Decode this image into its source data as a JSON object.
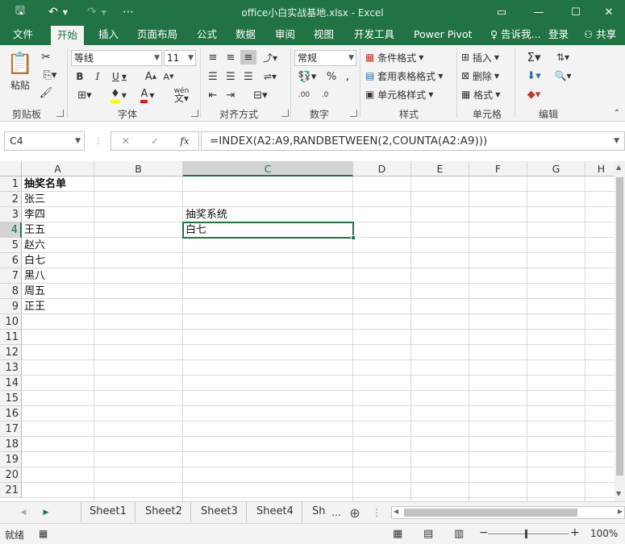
{
  "title": "office小白实战基地.xlsx - Excel",
  "quick_access": {
    "save": "🖫",
    "undo": "↶",
    "redo": "↷",
    "customize": "⋯"
  },
  "window": {
    "restore_icon": "▭",
    "minimize": "—",
    "maximize": "☐",
    "close": "✕"
  },
  "tabs": [
    "文件",
    "开始",
    "插入",
    "页面布局",
    "公式",
    "数据",
    "审阅",
    "视图",
    "开发工具",
    "Power Pivot"
  ],
  "active_tab": "开始",
  "tell_me": "告诉我...",
  "login": "登录",
  "share": "共享",
  "ribbon": {
    "clipboard": {
      "paste": "粘贴",
      "label": "剪贴板"
    },
    "font": {
      "name": "等线",
      "size": "11",
      "label": "字体",
      "bold": "B",
      "italic": "I",
      "underline": "U"
    },
    "alignment": {
      "label": "对齐方式"
    },
    "number": {
      "format": "常规",
      "label": "数字",
      "percent": "%",
      "comma": ","
    },
    "styles": {
      "conditional": "条件格式",
      "table": "套用表格格式",
      "cell_style": "单元格样式",
      "label": "样式"
    },
    "cells": {
      "insert": "插入",
      "delete": "删除",
      "format": "格式",
      "label": "单元格"
    },
    "editing": {
      "label": "编辑"
    }
  },
  "formula_bar": {
    "name_box": "C4",
    "cancel": "✕",
    "enter": "✓",
    "fx": "fx",
    "formula": "=INDEX(A2:A9,RANDBETWEEN(2,COUNTA(A2:A9)))"
  },
  "columns": [
    "A",
    "B",
    "C",
    "D",
    "E",
    "F",
    "G",
    "H"
  ],
  "rows": [
    "1",
    "2",
    "3",
    "4",
    "5",
    "6",
    "7",
    "8",
    "9",
    "10",
    "11",
    "12",
    "13",
    "14",
    "15",
    "16",
    "17",
    "18",
    "19",
    "20",
    "21"
  ],
  "cells": {
    "A1": "抽奖名单",
    "A2": "张三",
    "A3": "李四",
    "A4": "王五",
    "A5": "赵六",
    "A6": "白七",
    "A7": "黑八",
    "A8": "周五",
    "A9": "正王",
    "C3": "抽奖系统",
    "C4": "白七"
  },
  "selected_cell": "C4",
  "sheets": [
    "Sheet1",
    "Sheet2",
    "Sheet3",
    "Sheet4",
    "Sh"
  ],
  "sheet_nav": {
    "prev": "◀",
    "next": "▶",
    "more": "...",
    "add": "⊕"
  },
  "status": {
    "ready": "就绪",
    "zoom": "100%",
    "zoom_minus": "−",
    "zoom_plus": "+"
  },
  "colors": {
    "accent": "#217346",
    "ribbon_bg": "#f3f3f3"
  }
}
